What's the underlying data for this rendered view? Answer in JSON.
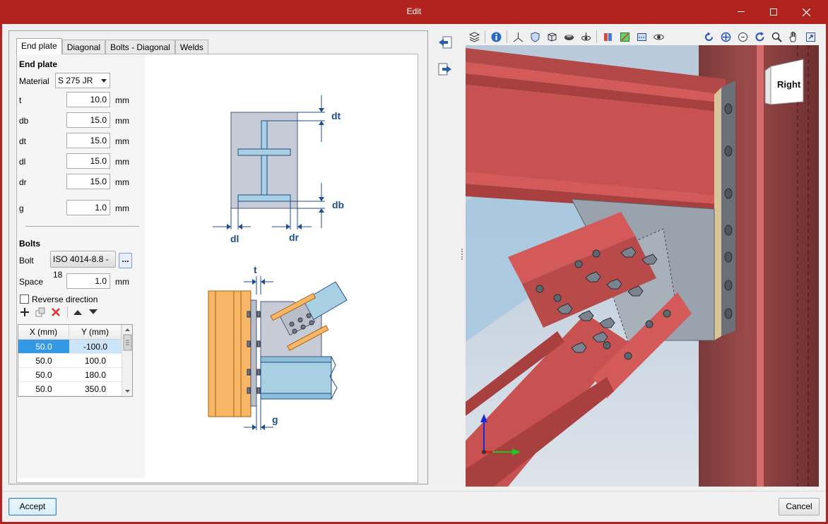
{
  "window": {
    "title": "Edit"
  },
  "tabs": [
    {
      "label": "End plate",
      "active": true
    },
    {
      "label": "Diagonal",
      "active": false
    },
    {
      "label": "Bolts - Diagonal",
      "active": false
    },
    {
      "label": "Welds",
      "active": false
    }
  ],
  "end_plate": {
    "heading": "End plate",
    "material_label": "Material",
    "material_value": "S 275 JR",
    "fields": [
      {
        "label": "t",
        "value": "10.0",
        "unit": "mm"
      },
      {
        "label": "db",
        "value": "15.0",
        "unit": "mm"
      },
      {
        "label": "dt",
        "value": "15.0",
        "unit": "mm"
      },
      {
        "label": "dl",
        "value": "15.0",
        "unit": "mm"
      },
      {
        "label": "dr",
        "value": "15.0",
        "unit": "mm"
      },
      {
        "label": "g",
        "value": "1.0",
        "unit": "mm"
      }
    ]
  },
  "bolts": {
    "heading": "Bolts",
    "bolt_label": "Bolt",
    "bolt_value": "ISO 4014-8.8 - 18",
    "dots": "...",
    "space_label": "Space",
    "space_value": "1.0",
    "space_unit": "mm",
    "reverse_label": "Reverse direction",
    "reverse_checked": false,
    "columns": [
      "X (mm)",
      "Y (mm)"
    ],
    "rows": [
      {
        "x": "50.0",
        "y": "-100.0"
      },
      {
        "x": "50.0",
        "y": "100.0"
      },
      {
        "x": "50.0",
        "y": "180.0"
      },
      {
        "x": "50.0",
        "y": "350.0"
      }
    ]
  },
  "diagram": {
    "labels": {
      "dt": "dt",
      "db": "db",
      "dl": "dl",
      "dr": "dr",
      "t": "t",
      "g": "g"
    }
  },
  "viewer": {
    "view_cube_label": "Right"
  },
  "footer": {
    "accept": "Accept",
    "cancel": "Cancel"
  },
  "colors": {
    "title_bar": "#b0231f",
    "steel_red": "#d45a5a",
    "plate_grey": "#8f99a6",
    "diagram_blue": "#1f4e8c",
    "diagram_orange": "#f7b766",
    "diagram_lightblue": "#a9cfe3"
  }
}
